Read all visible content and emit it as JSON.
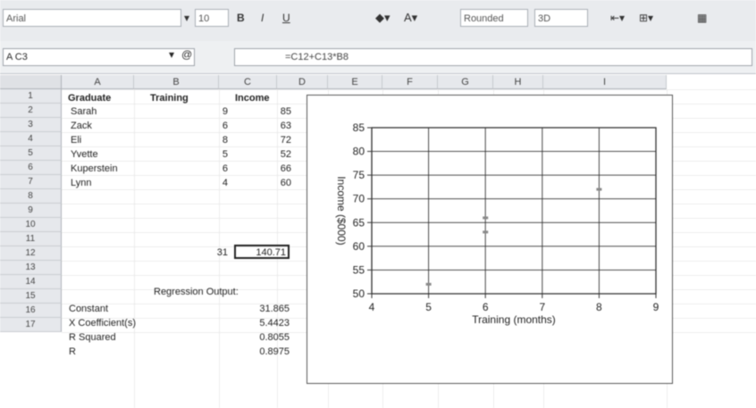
{
  "toolbar": {
    "font_name": "Arial",
    "font_size": "10",
    "bold": "B",
    "italic": "I",
    "underline": "U",
    "number_format": "Rounded",
    "decimals": "3D"
  },
  "formula_bar": {
    "cell_ref": "A C3",
    "fx_label": "@",
    "formula": "=C12+C13*B8"
  },
  "columns": [
    "A",
    "B",
    "C",
    "D",
    "E",
    "F",
    "G",
    "H",
    "I"
  ],
  "rows": [
    "1",
    "2",
    "3",
    "4",
    "5",
    "6",
    "7",
    "8",
    "9",
    "10",
    "11",
    "12",
    "13",
    "14",
    "15",
    "16",
    "17"
  ],
  "table": {
    "headers": [
      "Graduate",
      "Training",
      "Income"
    ],
    "rows": [
      [
        "Sarah",
        "9",
        "85"
      ],
      [
        "Zack",
        "6",
        "63"
      ],
      [
        "Eli",
        "8",
        "72"
      ],
      [
        "Yvette",
        "5",
        "52"
      ],
      [
        "Kuperstein",
        "6",
        "66"
      ],
      [
        "Lynn",
        "4",
        "60"
      ]
    ],
    "sum_training": "31",
    "predicted": "140.71"
  },
  "regression": {
    "title": "Regression Output:",
    "rows": [
      [
        "Constant",
        "31.865"
      ],
      [
        "X Coefficient(s)",
        "5.4423"
      ],
      [
        "R Squared",
        "0.8055"
      ],
      [
        "R",
        "0.8975"
      ]
    ]
  },
  "chart_data": {
    "type": "scatter",
    "xlabel": "Training (months)",
    "ylabel": "Income ($000)",
    "xlim": [
      4,
      9
    ],
    "ylim": [
      50,
      85
    ],
    "xticks": [
      "4",
      "5",
      "6",
      "7",
      "8",
      "9"
    ],
    "yticks": [
      "50",
      "55",
      "60",
      "65",
      "70",
      "75",
      "80",
      "85"
    ],
    "points": [
      {
        "x": 5,
        "y": 52
      },
      {
        "x": 6,
        "y": 63
      },
      {
        "x": 6,
        "y": 66
      },
      {
        "x": 8,
        "y": 72
      }
    ]
  }
}
